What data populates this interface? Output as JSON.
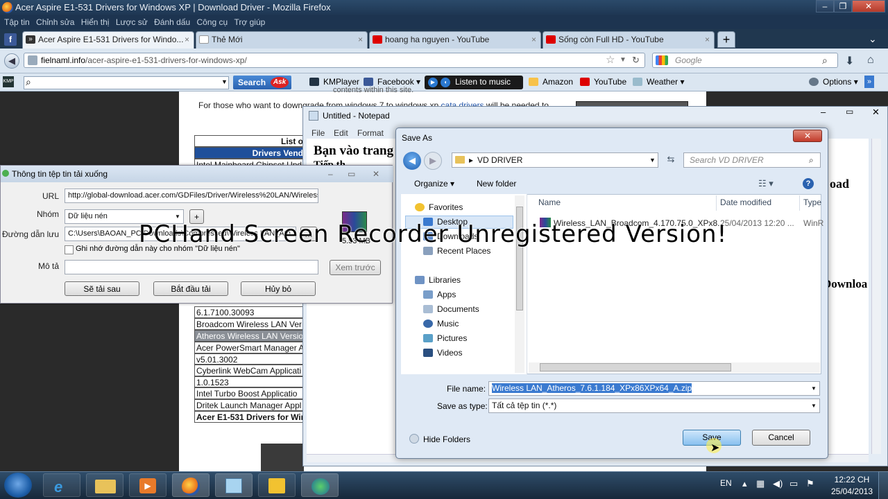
{
  "firefox": {
    "title": "Acer Aspire E1-531 Drivers for Windows XP | Download Driver - Mozilla Firefox",
    "menu": [
      "Tập tin",
      "Chỉnh sửa",
      "Hiển thị",
      "Lược sử",
      "Đánh dấu",
      "Công cụ",
      "Trợ giúp"
    ],
    "tabs": [
      {
        "label": "Acer Aspire E1-531 Drivers for Windo...",
        "close": "×"
      },
      {
        "label": "Thẻ Mới",
        "close": "×"
      },
      {
        "label": "hoang ha nguyen - YouTube",
        "close": "×"
      },
      {
        "label": "Sống còn Full HD - YouTube",
        "close": "×"
      }
    ],
    "new_tab": "+",
    "url_domain": "fielnaml.info",
    "url_path": "/acer-aspire-e1-531-drivers-for-windows-xp/",
    "google_placeholder": "Google",
    "toolbar": {
      "search_label": "Search",
      "ask_label": "Ask",
      "kmplayer": "KMPlayer",
      "facebook": "Facebook",
      "listen": "Listen to music",
      "amazon": "Amazon",
      "youtube": "YouTube",
      "weather": "Weather",
      "options": "Options"
    }
  },
  "webpage": {
    "line_top": "contents within this site.",
    "line1_pre": "For those who want to downgrade from windows 7 to windows xp ",
    "line1_link": "cata drivers",
    "line1_post": " will be needed to",
    "table_head1": "List o",
    "table_head2": "Drivers Vend",
    "rows": [
      "Intel Mainboard Chipset Upd",
      "6.1.7100.30093",
      "Broadcom Wireless LAN Ver",
      "Atheros Wireless LAN Versio",
      "Acer PowerSmart Manager A",
      "v5.01.3002",
      "Cyberlink WebCam Applicati",
      "1.0.1523",
      "Intel Turbo Boost Applicatio",
      "Dritek Launch Manager Appl",
      "Acer E1-531 Drivers for Win"
    ]
  },
  "notepad": {
    "title": "Untitled - Notepad",
    "menu": [
      "File",
      "Edit",
      "Format"
    ],
    "text1": "Bạn vào trang",
    "text2": "Tiếp th",
    "right1": "oad",
    "right2": "Downloa"
  },
  "download_dialog": {
    "title": "Thông tin tệp tin tải xuống",
    "url_label": "URL",
    "url_value": "http://global-download.acer.com/GDFiles/Driver/Wireless%20LAN/Wireless",
    "group_label": "Nhóm",
    "group_value": "Dữ liệu nén",
    "add_btn": "+",
    "path_label": "Đường dẫn lưu",
    "path_value": "C:\\Users\\BAOAN_PC\\Downloads\\Compressed\\Wireless LAN_Ath",
    "remember": "Ghi nhớ đường dẫn này cho nhóm \"Dữ liệu nén\"",
    "desc_label": "Mô tả",
    "preview_btn": "Xem trước",
    "size": "5.53 MB",
    "btn_later": "Sẽ tải sau",
    "btn_start": "Bắt đầu tải",
    "btn_cancel": "Hủy bỏ"
  },
  "save_as": {
    "title": "Save As",
    "path": "VD DRIVER",
    "search_placeholder": "Search VD DRIVER",
    "organize": "Organize",
    "new_folder": "New folder",
    "sidebar": {
      "favorites": "Favorites",
      "desktop": "Desktop",
      "downloads": "Downloads",
      "recent": "Recent Places",
      "libraries": "Libraries",
      "apps": "Apps",
      "documents": "Documents",
      "music": "Music",
      "pictures": "Pictures",
      "videos": "Videos"
    },
    "columns": {
      "name": "Name",
      "modified": "Date modified",
      "type": "Type"
    },
    "file": {
      "name": "Wireless_LAN_Broadcom_4.170.75.0_XPx8...",
      "modified": "25/04/2013 12:20 ...",
      "type": "WinR"
    },
    "filename_label": "File name:",
    "filename_value": "Wireless LAN_Atheros_7.6.1.184_XPx86XPx64_A.zip",
    "savetype_label": "Save as type:",
    "savetype_value": "Tất cả tệp tin (*.*)",
    "hide_folders": "Hide Folders",
    "save_btn": "Save",
    "cancel_btn": "Cancel"
  },
  "watermark": "PCHand Screen Recorder Unregistered Version!",
  "taskbar": {
    "lang": "EN",
    "time": "12:22 CH",
    "date": "25/04/2013"
  }
}
